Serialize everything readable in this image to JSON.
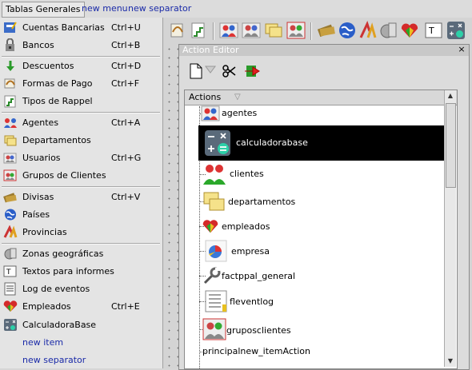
{
  "menubar": {
    "tablas_generales": "Tablas Generales",
    "new_menu": "new menu",
    "new_separator": "new separator"
  },
  "menu": {
    "items": [
      {
        "label": "Cuentas Bancarias",
        "shortcut": "Ctrl+U",
        "icon": "bank-accounts-icon"
      },
      {
        "label": "Bancos",
        "shortcut": "Ctrl+B",
        "icon": "bank-lock-icon"
      },
      {
        "label": "Descuentos",
        "shortcut": "Ctrl+D",
        "icon": "discount-icon"
      },
      {
        "label": "Formas de Pago",
        "shortcut": "Ctrl+F",
        "icon": "payment-icon"
      },
      {
        "label": "Tipos de Rappel",
        "shortcut": "",
        "icon": "rappel-icon"
      },
      {
        "label": "Agentes",
        "shortcut": "Ctrl+A",
        "icon": "agents-icon"
      },
      {
        "label": "Departamentos",
        "shortcut": "",
        "icon": "departments-icon"
      },
      {
        "label": "Usuarios",
        "shortcut": "Ctrl+G",
        "icon": "users-icon"
      },
      {
        "label": "Grupos de Clientes",
        "shortcut": "",
        "icon": "client-groups-icon"
      },
      {
        "label": "Divisas",
        "shortcut": "Ctrl+V",
        "icon": "currency-icon"
      },
      {
        "label": "Países",
        "shortcut": "",
        "icon": "globe-icon"
      },
      {
        "label": "Provincias",
        "shortcut": "",
        "icon": "provinces-icon"
      },
      {
        "label": "Zonas geográficas",
        "shortcut": "",
        "icon": "zones-icon"
      },
      {
        "label": "Textos para informes",
        "shortcut": "",
        "icon": "texts-icon"
      },
      {
        "label": "Log de eventos",
        "shortcut": "",
        "icon": "log-icon"
      },
      {
        "label": "Empleados",
        "shortcut": "Ctrl+E",
        "icon": "employees-icon"
      },
      {
        "label": "CalculadoraBase",
        "shortcut": "",
        "icon": "calculator-icon"
      },
      {
        "label": "new item",
        "shortcut": "",
        "icon": ""
      },
      {
        "label": "new separator",
        "shortcut": "",
        "icon": ""
      }
    ]
  },
  "action_editor": {
    "title": "Action Editor",
    "close": "×",
    "header": "Actions",
    "actions": [
      {
        "label": "agentes",
        "icon": "agents-icon"
      },
      {
        "label": "calculadorabase",
        "icon": "calculator-icon",
        "selected": true
      },
      {
        "label": "clientes",
        "icon": "clients-icon"
      },
      {
        "label": "departamentos",
        "icon": "departments-icon"
      },
      {
        "label": "empleados",
        "icon": "employees-icon"
      },
      {
        "label": "empresa",
        "icon": "company-icon"
      },
      {
        "label": "factppal_general",
        "icon": "wrench-icon"
      },
      {
        "label": "fleventlog",
        "icon": "log-icon"
      },
      {
        "label": "gruposclientes",
        "icon": "client-groups-icon"
      },
      {
        "label": "principalnew_itemAction",
        "icon": ""
      }
    ]
  }
}
